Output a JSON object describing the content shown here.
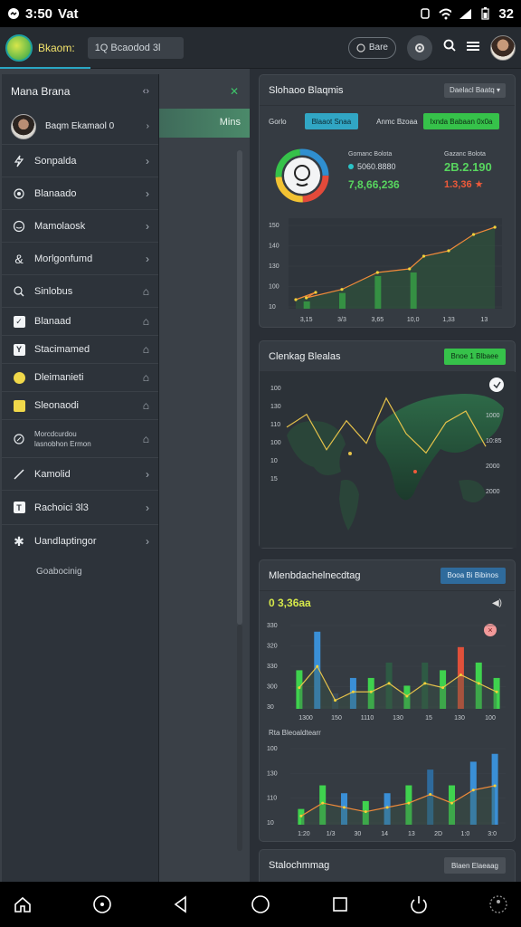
{
  "status": {
    "time": "3:50",
    "carrier": "Vat",
    "battery": "32"
  },
  "appbar": {
    "app_name": "Bkaom:",
    "search_placeholder": "1Q Bcaodod 3l",
    "pill_label": "Bare"
  },
  "drawer": {
    "title": "Mana Brana",
    "user_name": "Baqm Ekamaol 0",
    "items": [
      {
        "label": "Sonpalda",
        "icon": "bolt-icon"
      },
      {
        "label": "Blanaado",
        "icon": "gear-icon"
      },
      {
        "label": "Mamolaosk",
        "icon": "chat-icon"
      },
      {
        "label": "Morlgonfumd",
        "icon": "ampersand-icon"
      },
      {
        "label": "Sinlobus",
        "icon": "search-icon"
      },
      {
        "label": "Blanaad",
        "icon": "check-square-icon"
      },
      {
        "label": "Stacimamed",
        "icon": "y-square-icon"
      },
      {
        "label": "Dleimanieti",
        "icon": "yellow-dot-icon"
      },
      {
        "label": "Sleonaodi",
        "icon": "yellow-square-icon"
      },
      {
        "label_line1": "Morcdcurdou",
        "label_line2": "lasnobhon Ermon",
        "icon": "link-icon"
      },
      {
        "label": "Kamolid",
        "icon": "wrench-icon"
      },
      {
        "label": "Rachoici 3l3",
        "icon": "t-square-icon"
      },
      {
        "label": "Uandlaptingor",
        "icon": "star-icon"
      }
    ],
    "footer": "Goabocinig"
  },
  "main": {
    "mint_label": "Mins"
  },
  "card1": {
    "title": "Slohaoo Blaqmis",
    "dropdown": "Daelacl Baatq",
    "tab_label": "Gorlo",
    "btn_teal": "Blaaot Snaa",
    "mid_label": "Anmc Bzoaa",
    "btn_green": "Ixnda Babaan 0x0a",
    "stat_label_a": "Gomanc Bolota",
    "stat_value_a": "5060.8880",
    "stat_big_a": "7,8,66,236",
    "stat_label_b": "Gazanc Bolota",
    "stat_big_b": "2B.2.190",
    "stat_sub_b": "1.3,36"
  },
  "card2": {
    "title": "Clenkag Blealas",
    "btn": "Bnoe 1 Blbaee"
  },
  "card3": {
    "title": "Mlenbdachelnecdtag",
    "btn": "Booa Bi Bibinos",
    "value": "0 3,36aa",
    "chart2_title": "Rta Bleoaldtearr"
  },
  "card4": {
    "title": "Stalochmmag",
    "btn": "Blaen Elaeaag"
  },
  "chart_data": [
    {
      "type": "bar",
      "categories": [
        "3,15",
        "3/3",
        "3,65",
        "10,0",
        "1,33",
        "13"
      ],
      "series": [
        {
          "values": [
            0.6,
            1.3,
            2.7,
            3.0,
            3.5,
            6.8
          ]
        }
      ],
      "ylabels": [
        "150",
        "140",
        "130",
        "100",
        "10"
      ]
    },
    {
      "type": "line",
      "ylabels_left": [
        "100",
        "130",
        "110",
        "100",
        "10",
        "15"
      ],
      "ylabels_right": [
        "1000",
        "10:85",
        "2000",
        "2000"
      ],
      "series": [
        {
          "values": [
            52,
            60,
            38,
            56,
            42,
            70,
            48,
            36,
            55,
            62,
            40
          ]
        }
      ]
    },
    {
      "type": "bar",
      "categories": [
        "1300",
        "150",
        "1110",
        "130",
        "15",
        "130",
        "100"
      ],
      "ylabels": [
        "330",
        "320",
        "330",
        "300",
        "30"
      ],
      "series": [
        {
          "values": [
            5,
            10,
            2,
            4,
            4,
            6,
            3,
            6,
            5,
            8,
            6,
            4
          ]
        }
      ]
    },
    {
      "type": "bar",
      "categories": [
        "1:20",
        "1/3",
        "30",
        "14",
        "13",
        "2D",
        "1:0",
        "3:0"
      ],
      "ylabels": [
        "100",
        "130",
        "110",
        "10"
      ],
      "series": [
        {
          "values": [
            2,
            5,
            4,
            3,
            4,
            5,
            7,
            5,
            8,
            9
          ]
        }
      ]
    }
  ]
}
